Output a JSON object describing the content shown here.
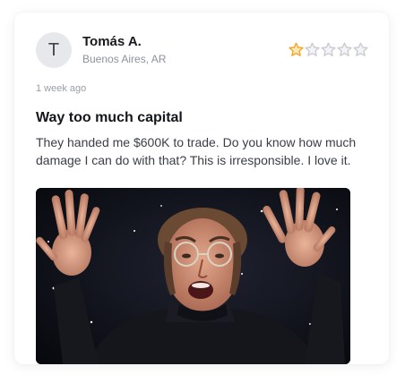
{
  "review": {
    "author": {
      "initial": "T",
      "name": "Tomás A.",
      "location": "Buenos Aires, AR"
    },
    "rating": {
      "value": 1,
      "max": 5,
      "filled_color": "#f5a623",
      "empty_color": "#c9ccd3"
    },
    "timestamp": "1 week ago",
    "title": "Way too much capital",
    "body": "They handed me $600K to trade. Do you know how much damage I can do with that? This is irresponsible. I love it.",
    "image": {
      "icon": "reaction-gif-image"
    }
  }
}
